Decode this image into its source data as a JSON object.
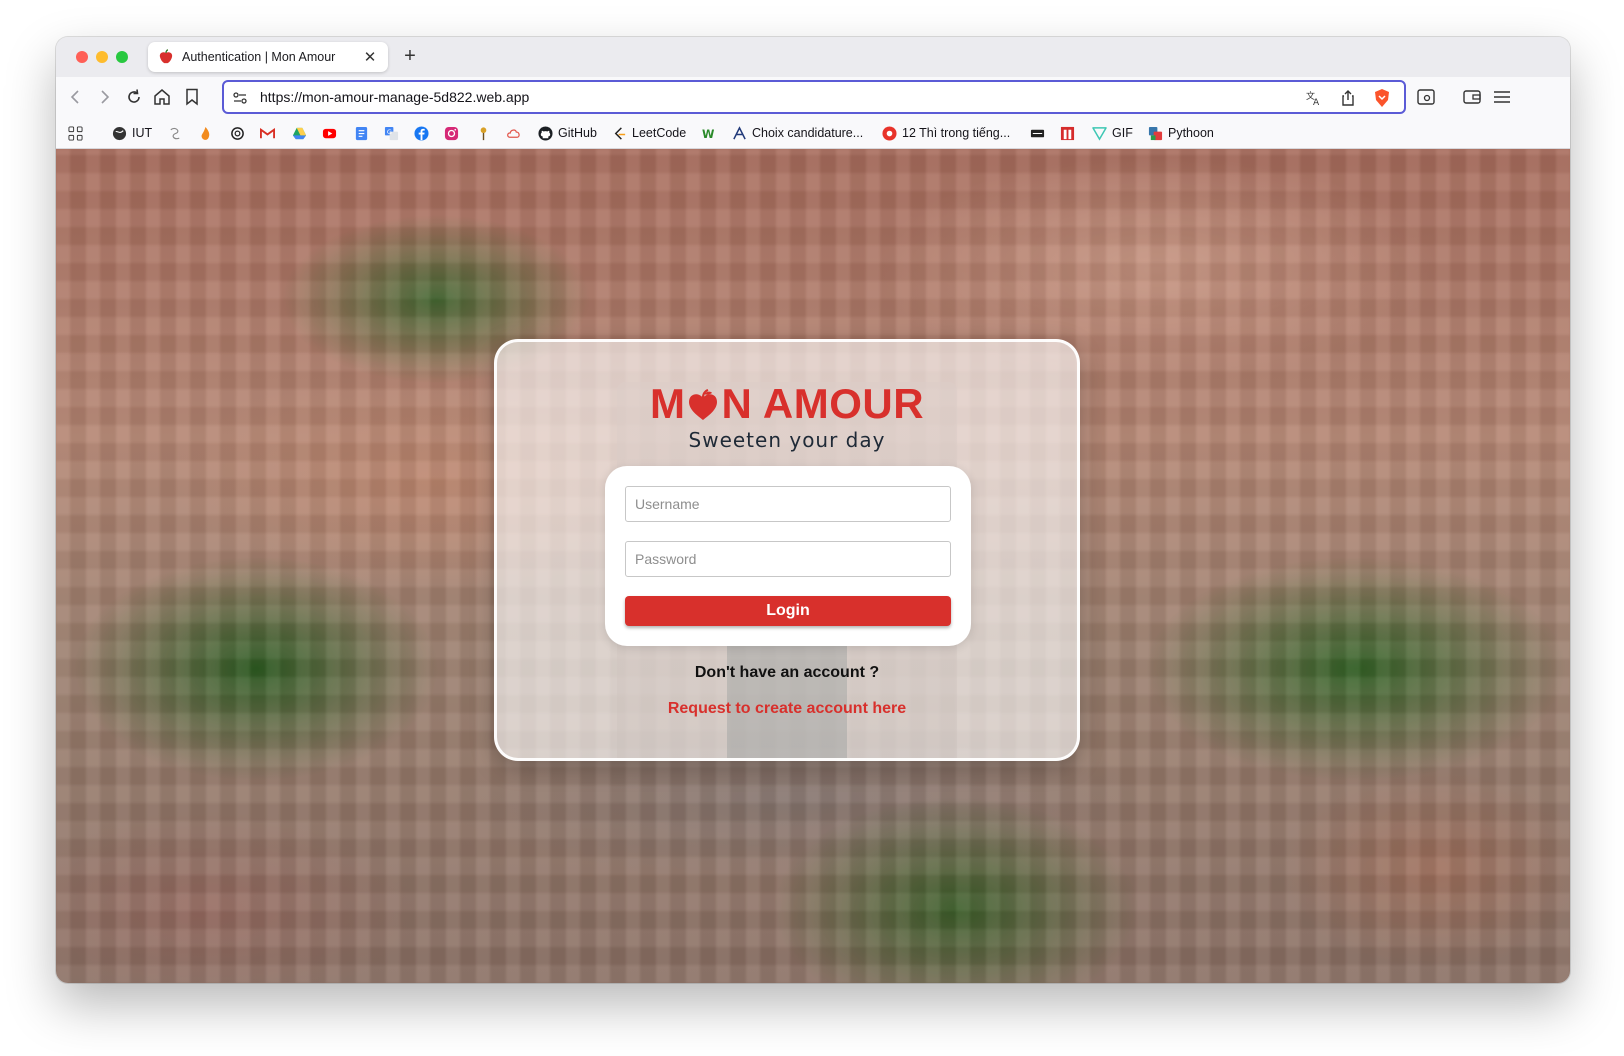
{
  "window": {
    "traffic_lights": [
      "#ff5f57",
      "#febc2e",
      "#28c840"
    ]
  },
  "tab": {
    "title": "Authentication | Mon Amour",
    "close": "✕",
    "new_tab": "+"
  },
  "navbar": {
    "url": "https://mon-amour-manage-5d822.web.app",
    "accent": "#5b5bd6"
  },
  "bookmarks": [
    {
      "label": "",
      "icon": "apps-grid-icon"
    },
    {
      "label": "IUT",
      "icon": "globe-icon"
    },
    {
      "label": "",
      "icon": "swirl-icon"
    },
    {
      "label": "",
      "icon": "flame-icon"
    },
    {
      "label": "",
      "icon": "openai-icon"
    },
    {
      "label": "",
      "icon": "gmail-icon"
    },
    {
      "label": "",
      "icon": "drive-icon"
    },
    {
      "label": "",
      "icon": "youtube-icon"
    },
    {
      "label": "",
      "icon": "docs-icon"
    },
    {
      "label": "",
      "icon": "translate-icon"
    },
    {
      "label": "",
      "icon": "facebook-icon"
    },
    {
      "label": "",
      "icon": "instagram-icon"
    },
    {
      "label": "",
      "icon": "plant-icon"
    },
    {
      "label": "",
      "icon": "cloud-icon"
    },
    {
      "label": "GitHub",
      "icon": "github-icon"
    },
    {
      "label": "LeetCode",
      "icon": "leetcode-icon"
    },
    {
      "label": "",
      "icon": "w-icon"
    },
    {
      "label": "Choix candidature...",
      "icon": "pen-icon"
    },
    {
      "label": "12 Thì trong tiếng...",
      "icon": "red-circle-icon"
    },
    {
      "label": "",
      "icon": "dark-badge-icon"
    },
    {
      "label": "",
      "icon": "red-square-icon"
    },
    {
      "label": "GIF",
      "icon": "gif-icon"
    },
    {
      "label": "Pythoon",
      "icon": "python-icon"
    }
  ],
  "card": {
    "logo_left": "M",
    "logo_right": "N AMOUR",
    "tagline": "Sweeten your day",
    "username_placeholder": "Username",
    "password_placeholder": "Password",
    "login_label": "Login",
    "no_account_text": "Don't have an account ?",
    "request_link": "Request to create account here",
    "brand_color": "#d8302c"
  }
}
